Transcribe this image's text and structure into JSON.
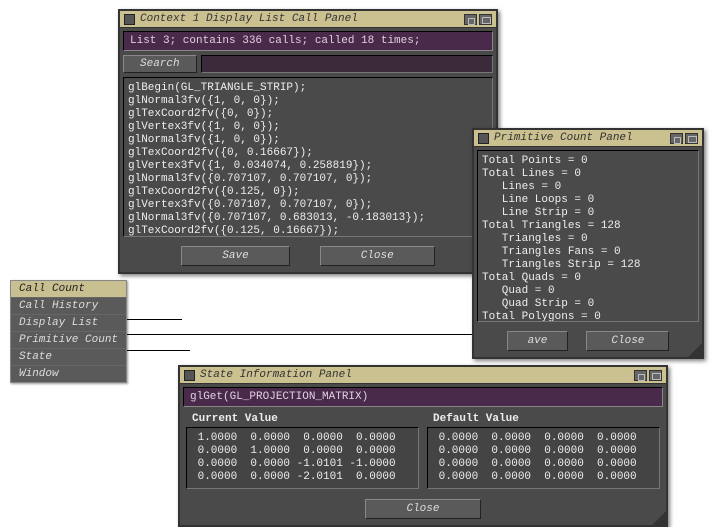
{
  "menu": {
    "items": [
      "Call Count",
      "Call History",
      "Display List",
      "Primitive Count",
      "State",
      "Window"
    ],
    "active_index": 0
  },
  "call_panel": {
    "title": "Context 1 Display List Call Panel",
    "status": "List 3;  contains 336 calls;  called 18 times;",
    "search_label": "Search",
    "code": "glBegin(GL_TRIANGLE_STRIP);\nglNormal3fv({1, 0, 0});\nglTexCoord2fv({0, 0});\nglVertex3fv({1, 0, 0});\nglNormal3fv({1, 0, 0});\nglTexCoord2fv({0, 0.16667});\nglVertex3fv({1, 0.034074, 0.258819});\nglNormal3fv({0.707107, 0.707107, 0});\nglTexCoord2fv({0.125, 0});\nglVertex3fv({0.707107, 0.707107, 0});\nglNormal3fv({0.707107, 0.683013, -0.183013});\nglTexCoord2fv({0.125, 0.16667});",
    "save_label": "Save",
    "close_label": "Close"
  },
  "prim_panel": {
    "title": "Primitive Count Panel",
    "text": "Total Points = 0\nTotal Lines = 0\n   Lines = 0\n   Line Loops = 0\n   Line Strip = 0\nTotal Triangles = 128\n   Triangles = 0\n   Triangles Fans = 0\n   Triangles Strip = 128\nTotal Quads = 0\n   Quad = 0\n   Quad Strip = 0\nTotal Polygons = 0",
    "save_label": "ave",
    "close_label": "Close"
  },
  "state_panel": {
    "title": "State Information Panel",
    "status": "glGet(GL_PROJECTION_MATRIX)",
    "current_header": "Current Value",
    "default_header": "Default Value",
    "current": " 1.0000  0.0000  0.0000  0.0000\n 0.0000  1.0000  0.0000  0.0000\n 0.0000  0.0000 -1.0101 -1.0000\n 0.0000  0.0000 -2.0101  0.0000",
    "default": " 0.0000  0.0000  0.0000  0.0000\n 0.0000  0.0000  0.0000  0.0000\n 0.0000  0.0000  0.0000  0.0000\n 0.0000  0.0000  0.0000  0.0000",
    "close_label": "Close"
  }
}
